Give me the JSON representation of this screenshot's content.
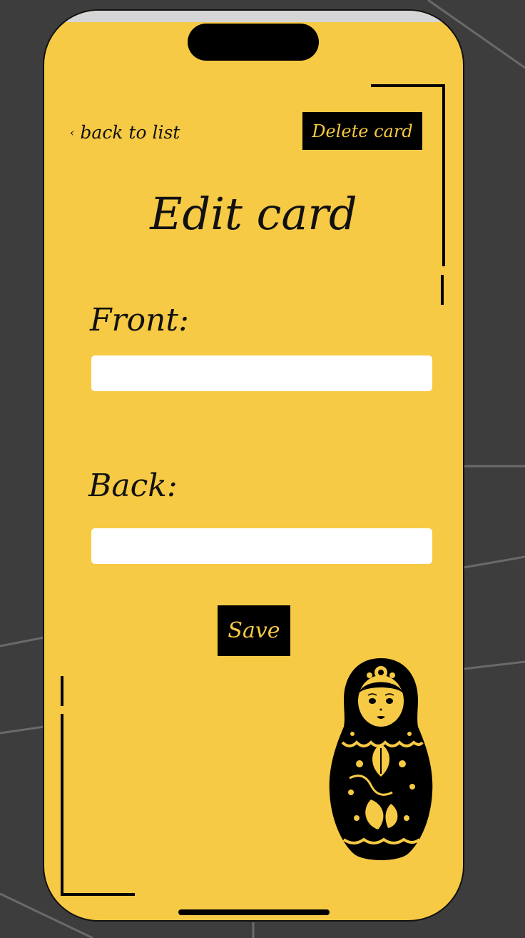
{
  "nav": {
    "back_label": "back to list",
    "back_chevron": "‹"
  },
  "actions": {
    "delete_label": "Delete card",
    "save_label": "Save"
  },
  "page": {
    "title": "Edit card"
  },
  "form": {
    "front_label": "Front:",
    "front_value": "",
    "back_label": "Back:",
    "back_value": ""
  },
  "theme": {
    "accent": "#f7ca45",
    "ink": "#000000",
    "background": "#3d3d3d"
  },
  "icons": {
    "illustration": "matryoshka-doll-icon"
  }
}
